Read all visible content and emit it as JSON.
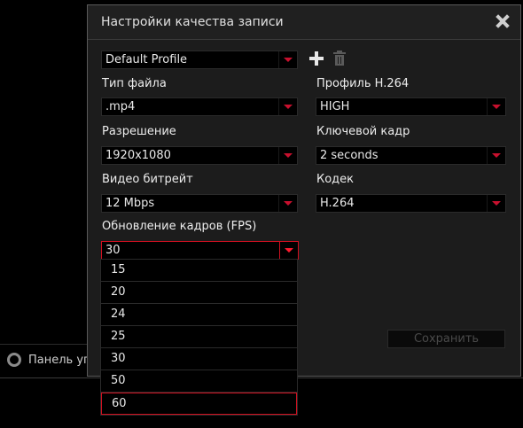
{
  "background": {
    "panel_label": "Панель уп"
  },
  "dialog": {
    "title": "Настройки качества записи",
    "profile": {
      "value": "Default Profile"
    },
    "file_type": {
      "label": "Тип файла",
      "value": ".mp4"
    },
    "resolution": {
      "label": "Разрешение",
      "value": "1920x1080"
    },
    "video_bitrate": {
      "label": "Видео битрейт",
      "value": "12 Mbps"
    },
    "fps": {
      "label": "Обновление кадров (FPS)",
      "value": "30"
    },
    "h264_profile": {
      "label": "Профиль H.264",
      "value": "HIGH"
    },
    "keyframe": {
      "label": "Ключевой кадр",
      "value": "2 seconds"
    },
    "codec": {
      "label": "Кодек",
      "value": "H.264"
    },
    "save_label": "Сохранить"
  },
  "fps_options": [
    "15",
    "20",
    "24",
    "25",
    "30",
    "50",
    "60"
  ],
  "colors": {
    "accent": "#d01020",
    "background": "#1c1c1c",
    "field": "#000000"
  },
  "icons": {
    "close": "close-icon",
    "add": "plus-icon",
    "delete": "trash-icon",
    "dropdown": "chevron-down-icon",
    "panel": "gear-icon"
  }
}
